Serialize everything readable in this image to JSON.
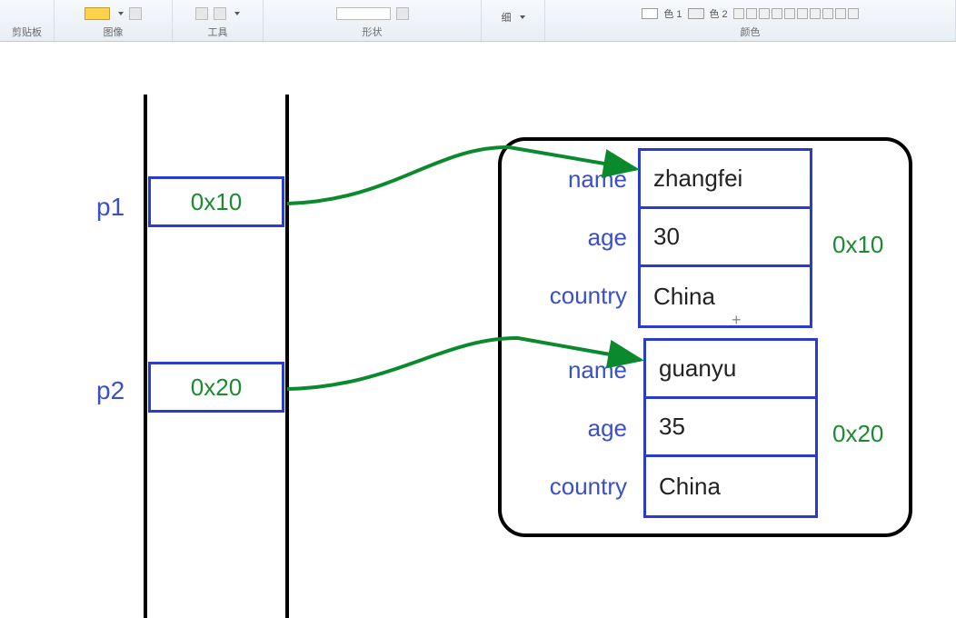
{
  "ribbon": {
    "groups": {
      "clipboard": "剪贴板",
      "image": "图像",
      "tools": "工具",
      "shapes": "形状",
      "thin_label": "细",
      "color1": "色 1",
      "color2": "色 2",
      "colors": "颜色"
    }
  },
  "diagram": {
    "pointers": [
      {
        "name": "p1",
        "address": "0x10"
      },
      {
        "name": "p2",
        "address": "0x20"
      }
    ],
    "objects": [
      {
        "address": "0x10",
        "fields": {
          "name": "zhangfei",
          "age": "30",
          "country": "China"
        },
        "field_labels": {
          "name": "name",
          "age": "age",
          "country": "country"
        }
      },
      {
        "address": "0x20",
        "fields": {
          "name": "guanyu",
          "age": "35",
          "country": "China"
        },
        "field_labels": {
          "name": "name",
          "age": "age",
          "country": "country"
        }
      }
    ]
  }
}
